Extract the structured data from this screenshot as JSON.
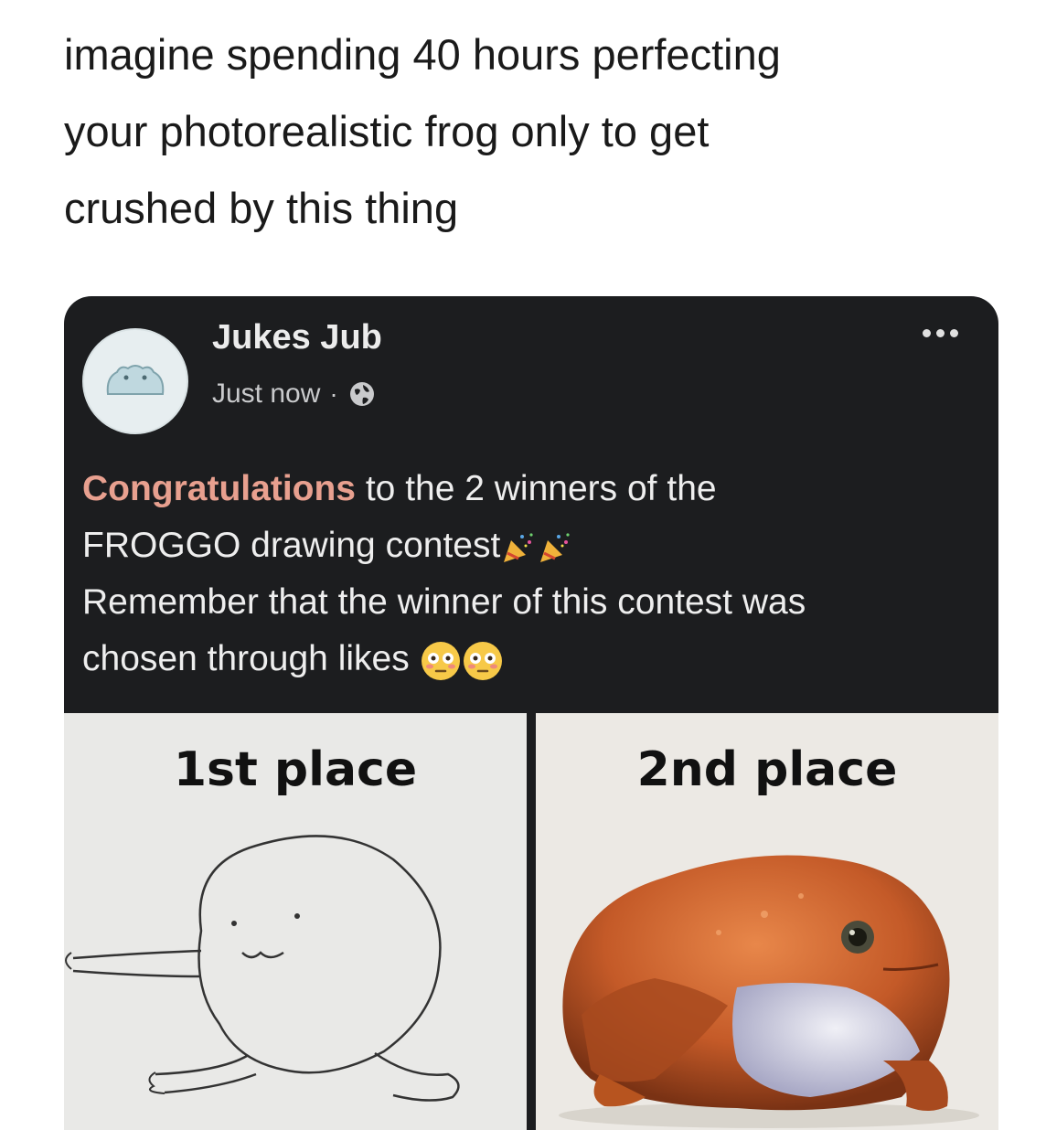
{
  "caption": {
    "lines": [
      "imagine spending 40 hours perfecting",
      "your photorealistic frog only to get",
      "crushed by this thing"
    ]
  },
  "post": {
    "author": "Jukes Jub",
    "time": "Just now",
    "separator": "·",
    "icons": {
      "avatar": "frog-avatar-icon",
      "privacy": "globe-icon",
      "menu": "more-options-icon"
    },
    "body": {
      "highlight": "Congratulations",
      "line1_rest": " to the 2 winners of the",
      "line2": "FROGGO drawing contest",
      "line3": "Remember that the winner of this contest was",
      "line4": "chosen through likes"
    },
    "images": [
      {
        "label": "1st place",
        "description_icon": "frog-doodle-drawing"
      },
      {
        "label": "2nd place",
        "description_icon": "realistic-frog-drawing"
      }
    ]
  },
  "colors": {
    "post_bg": "#1c1d1f",
    "highlight": "#e8a08f",
    "text": "#eeeeee"
  }
}
